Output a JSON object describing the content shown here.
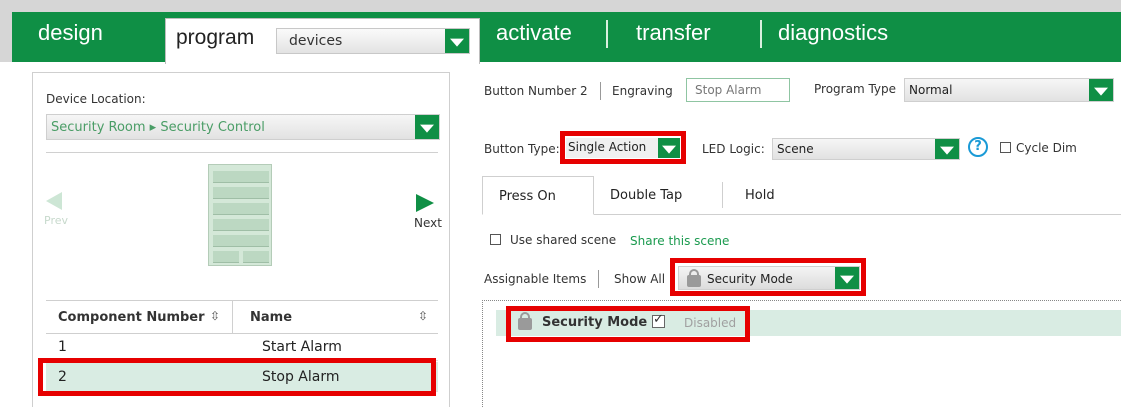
{
  "nav": {
    "design": "design",
    "program": "program",
    "devices_value": "devices",
    "activate": "activate",
    "transfer": "transfer",
    "diagnostics": "diagnostics"
  },
  "left": {
    "device_location_label": "Device Location:",
    "location_value": "Security Room ▸ Security Control",
    "prev_label": "Prev",
    "next_label": "Next",
    "table": {
      "col1": "Component Number",
      "col2": "Name",
      "rows": [
        {
          "num": "1",
          "name": "Start Alarm"
        },
        {
          "num": "2",
          "name": "Stop Alarm"
        }
      ]
    }
  },
  "right": {
    "button_number": "Button Number 2",
    "engraving_label": "Engraving",
    "engraving_value": "Stop Alarm",
    "program_type_label": "Program Type",
    "program_type_value": "Normal",
    "button_type_label": "Button Type:",
    "button_type_value": "Single Action",
    "led_logic_label": "LED Logic:",
    "led_logic_value": "Scene",
    "cycle_dim_label": "Cycle Dim",
    "tabs": [
      "Press On",
      "Double Tap",
      "Hold"
    ],
    "use_shared_scene": "Use shared scene",
    "share_this_scene": "Share this scene",
    "assignable_items": "Assignable Items",
    "show_all": "Show All",
    "filter_value": "Security Mode",
    "item": {
      "name": "Security Mode",
      "status": "Disabled"
    }
  }
}
